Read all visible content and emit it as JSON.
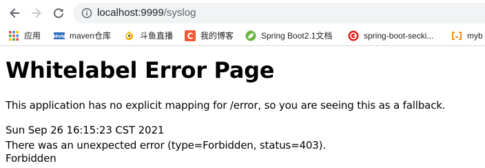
{
  "browser": {
    "address_bar": {
      "host": "localhost:9999",
      "path": "/syslog"
    },
    "bookmarks": [
      {
        "label": "应用",
        "icon": "apps-grid-icon"
      },
      {
        "label": "maven仓库",
        "icon": "mvn-icon"
      },
      {
        "label": "斗鱼直播",
        "icon": "douyu-icon"
      },
      {
        "label": "我的博客",
        "icon": "csdn-c-icon"
      },
      {
        "label": "Spring Boot2.1文档",
        "icon": "spring-leaf-icon"
      },
      {
        "label": "spring-boot-secki...",
        "icon": "github-icon"
      },
      {
        "label": "myb",
        "icon": "code-brackets-icon"
      }
    ],
    "colors": {
      "omnibox_bg": "#f1f3f4",
      "mvn_blue": "#2b6fc1",
      "csdn_red": "#ef5a34",
      "spring_green": "#6db33f",
      "github_red": "#d9221c",
      "mybatis_orange": "#f38b1b"
    }
  },
  "page": {
    "title": "Whitelabel Error Page",
    "message": "This application has no explicit mapping for /error, so you are seeing this as a fallback.",
    "timestamp": "Sun Sep 26 16:15:23 CST 2021",
    "error_line": "There was an unexpected error (type=Forbidden, status=403).",
    "status_text": "Forbidden"
  }
}
